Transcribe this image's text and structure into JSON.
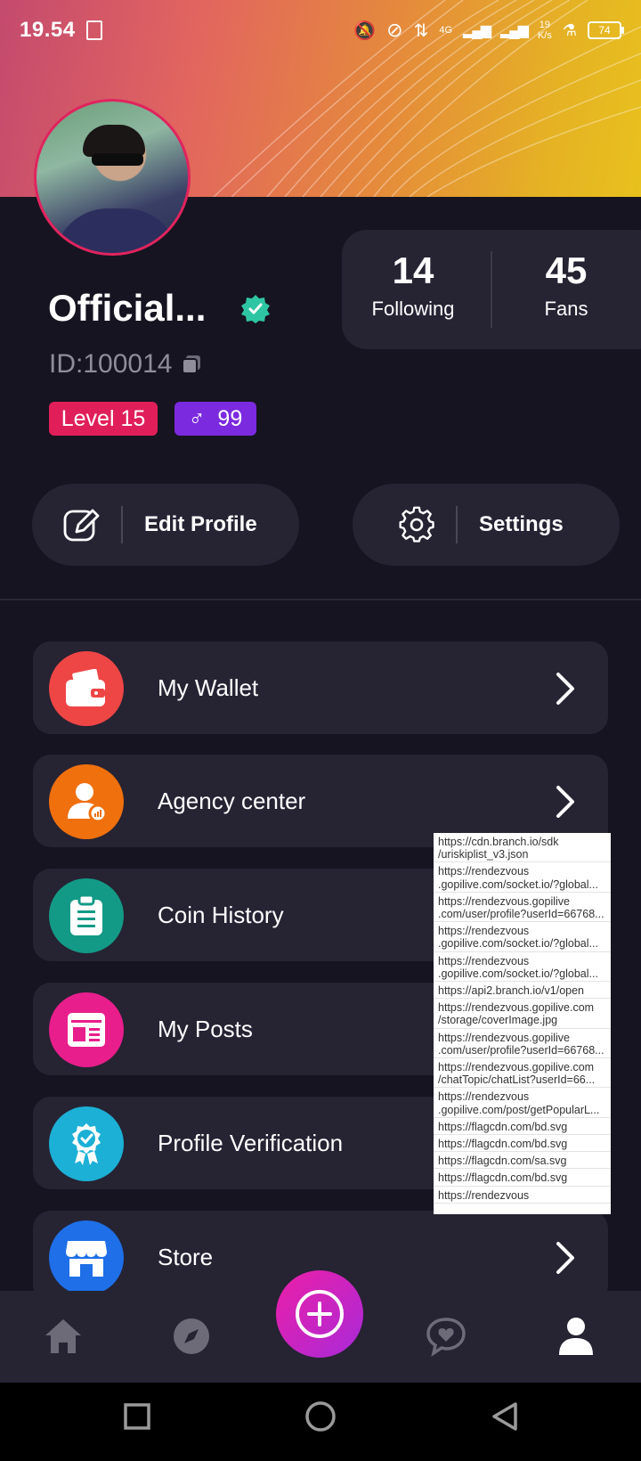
{
  "status_bar": {
    "time": "19.54",
    "network": "4G",
    "speed_value": "19",
    "speed_unit": "K/s",
    "battery": "74"
  },
  "profile": {
    "name": "Official...",
    "id_text": "ID:100014",
    "level_label": "Level 15",
    "gender_symbol": "♂",
    "gender_value": "99"
  },
  "stats": {
    "following_count": "14",
    "following_label": "Following",
    "fans_count": "45",
    "fans_label": "Fans"
  },
  "actions": {
    "edit_profile": "Edit Profile",
    "settings": "Settings"
  },
  "menu": [
    {
      "label": "My Wallet",
      "icon": "wallet-icon",
      "color": "#ee4545"
    },
    {
      "label": "Agency center",
      "icon": "agency-icon",
      "color": "#f0700e"
    },
    {
      "label": "Coin History",
      "icon": "clipboard-icon",
      "color": "#139a86"
    },
    {
      "label": "My Posts",
      "icon": "posts-icon",
      "color": "#e81e8c"
    },
    {
      "label": "Profile Verification",
      "icon": "verification-badge-icon",
      "color": "#1cb0d6"
    },
    {
      "label": "Store",
      "icon": "store-icon",
      "color": "#1e6fe8"
    }
  ],
  "network_log": [
    "https://cdn.branch.io/sdk/uriskiplist_v3.json",
    "https://rendezvous.gopilive.com/socket.io/?global...",
    "https://rendezvous.gopilive.com/user/profile?userId=66768...",
    "https://rendezvous.gopilive.com/socket.io/?global...",
    "https://rendezvous.gopilive.com/socket.io/?global...",
    "https://api2.branch.io/v1/open",
    "https://rendezvous.gopilive.com/storage/coverImage.jpg",
    "https://rendezvous.gopilive.com/user/profile?userId=66768...",
    "https://rendezvous.gopilive.com/chatTopic/chatList?userId=66...",
    "https://rendezvous.gopilive.com/post/getPopularL...",
    "https://flagcdn.com/bd.svg",
    "https://flagcdn.com/bd.svg",
    "https://flagcdn.com/sa.svg",
    "https://flagcdn.com/bd.svg",
    "https://rendezvous"
  ],
  "network_log_lines": [
    [
      "https://cdn.branch.io/sdk",
      "/uriskiplist_v3.json"
    ],
    [
      "https://rendezvous",
      ".gopilive.com/socket.io/?global..."
    ],
    [
      "https://rendezvous.gopilive",
      ".com/user/profile?userId=66768..."
    ],
    [
      "https://rendezvous",
      ".gopilive.com/socket.io/?global..."
    ],
    [
      "https://rendezvous",
      ".gopilive.com/socket.io/?global..."
    ],
    [
      "https://api2.branch.io/v1/open"
    ],
    [
      "https://rendezvous.gopilive.com",
      "/storage/coverImage.jpg"
    ],
    [
      "https://rendezvous.gopilive",
      ".com/user/profile?userId=66768..."
    ],
    [
      "https://rendezvous.gopilive.com",
      "/chatTopic/chatList?userId=66..."
    ],
    [
      "https://rendezvous",
      ".gopilive.com/post/getPopularL..."
    ],
    [
      "https://flagcdn.com/bd.svg"
    ],
    [
      "https://flagcdn.com/bd.svg"
    ],
    [
      "https://flagcdn.com/sa.svg"
    ],
    [
      "https://flagcdn.com/bd.svg"
    ],
    [
      "https://rendezvous"
    ]
  ],
  "bottom_nav": [
    "home-icon",
    "explore-compass-icon",
    "add-plus-icon",
    "chat-heart-icon",
    "profile-person-icon"
  ],
  "system_nav": [
    "recents-square-icon",
    "home-circle-icon",
    "back-triangle-icon"
  ],
  "colors": {
    "background": "#161420",
    "card": "#262333",
    "level_badge": "#e01f5a",
    "gender_badge": "#7c2ae0",
    "verified": "#2ec5a3",
    "fab_gradient_start": "#ec1fa7",
    "fab_gradient_end": "#a82ad9"
  }
}
